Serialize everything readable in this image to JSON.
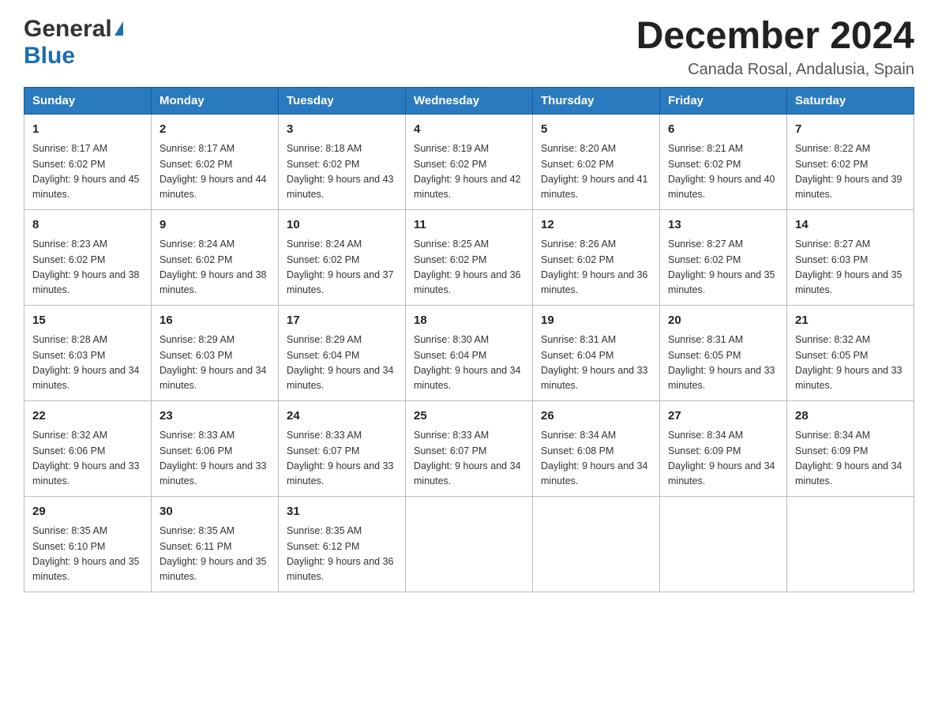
{
  "header": {
    "logo_general": "General",
    "logo_blue": "Blue",
    "month_title": "December 2024",
    "location": "Canada Rosal, Andalusia, Spain"
  },
  "days_of_week": [
    "Sunday",
    "Monday",
    "Tuesday",
    "Wednesday",
    "Thursday",
    "Friday",
    "Saturday"
  ],
  "weeks": [
    [
      {
        "day": "1",
        "sunrise": "8:17 AM",
        "sunset": "6:02 PM",
        "daylight": "9 hours and 45 minutes."
      },
      {
        "day": "2",
        "sunrise": "8:17 AM",
        "sunset": "6:02 PM",
        "daylight": "9 hours and 44 minutes."
      },
      {
        "day": "3",
        "sunrise": "8:18 AM",
        "sunset": "6:02 PM",
        "daylight": "9 hours and 43 minutes."
      },
      {
        "day": "4",
        "sunrise": "8:19 AM",
        "sunset": "6:02 PM",
        "daylight": "9 hours and 42 minutes."
      },
      {
        "day": "5",
        "sunrise": "8:20 AM",
        "sunset": "6:02 PM",
        "daylight": "9 hours and 41 minutes."
      },
      {
        "day": "6",
        "sunrise": "8:21 AM",
        "sunset": "6:02 PM",
        "daylight": "9 hours and 40 minutes."
      },
      {
        "day": "7",
        "sunrise": "8:22 AM",
        "sunset": "6:02 PM",
        "daylight": "9 hours and 39 minutes."
      }
    ],
    [
      {
        "day": "8",
        "sunrise": "8:23 AM",
        "sunset": "6:02 PM",
        "daylight": "9 hours and 38 minutes."
      },
      {
        "day": "9",
        "sunrise": "8:24 AM",
        "sunset": "6:02 PM",
        "daylight": "9 hours and 38 minutes."
      },
      {
        "day": "10",
        "sunrise": "8:24 AM",
        "sunset": "6:02 PM",
        "daylight": "9 hours and 37 minutes."
      },
      {
        "day": "11",
        "sunrise": "8:25 AM",
        "sunset": "6:02 PM",
        "daylight": "9 hours and 36 minutes."
      },
      {
        "day": "12",
        "sunrise": "8:26 AM",
        "sunset": "6:02 PM",
        "daylight": "9 hours and 36 minutes."
      },
      {
        "day": "13",
        "sunrise": "8:27 AM",
        "sunset": "6:02 PM",
        "daylight": "9 hours and 35 minutes."
      },
      {
        "day": "14",
        "sunrise": "8:27 AM",
        "sunset": "6:03 PM",
        "daylight": "9 hours and 35 minutes."
      }
    ],
    [
      {
        "day": "15",
        "sunrise": "8:28 AM",
        "sunset": "6:03 PM",
        "daylight": "9 hours and 34 minutes."
      },
      {
        "day": "16",
        "sunrise": "8:29 AM",
        "sunset": "6:03 PM",
        "daylight": "9 hours and 34 minutes."
      },
      {
        "day": "17",
        "sunrise": "8:29 AM",
        "sunset": "6:04 PM",
        "daylight": "9 hours and 34 minutes."
      },
      {
        "day": "18",
        "sunrise": "8:30 AM",
        "sunset": "6:04 PM",
        "daylight": "9 hours and 34 minutes."
      },
      {
        "day": "19",
        "sunrise": "8:31 AM",
        "sunset": "6:04 PM",
        "daylight": "9 hours and 33 minutes."
      },
      {
        "day": "20",
        "sunrise": "8:31 AM",
        "sunset": "6:05 PM",
        "daylight": "9 hours and 33 minutes."
      },
      {
        "day": "21",
        "sunrise": "8:32 AM",
        "sunset": "6:05 PM",
        "daylight": "9 hours and 33 minutes."
      }
    ],
    [
      {
        "day": "22",
        "sunrise": "8:32 AM",
        "sunset": "6:06 PM",
        "daylight": "9 hours and 33 minutes."
      },
      {
        "day": "23",
        "sunrise": "8:33 AM",
        "sunset": "6:06 PM",
        "daylight": "9 hours and 33 minutes."
      },
      {
        "day": "24",
        "sunrise": "8:33 AM",
        "sunset": "6:07 PM",
        "daylight": "9 hours and 33 minutes."
      },
      {
        "day": "25",
        "sunrise": "8:33 AM",
        "sunset": "6:07 PM",
        "daylight": "9 hours and 34 minutes."
      },
      {
        "day": "26",
        "sunrise": "8:34 AM",
        "sunset": "6:08 PM",
        "daylight": "9 hours and 34 minutes."
      },
      {
        "day": "27",
        "sunrise": "8:34 AM",
        "sunset": "6:09 PM",
        "daylight": "9 hours and 34 minutes."
      },
      {
        "day": "28",
        "sunrise": "8:34 AM",
        "sunset": "6:09 PM",
        "daylight": "9 hours and 34 minutes."
      }
    ],
    [
      {
        "day": "29",
        "sunrise": "8:35 AM",
        "sunset": "6:10 PM",
        "daylight": "9 hours and 35 minutes."
      },
      {
        "day": "30",
        "sunrise": "8:35 AM",
        "sunset": "6:11 PM",
        "daylight": "9 hours and 35 minutes."
      },
      {
        "day": "31",
        "sunrise": "8:35 AM",
        "sunset": "6:12 PM",
        "daylight": "9 hours and 36 minutes."
      },
      null,
      null,
      null,
      null
    ]
  ]
}
